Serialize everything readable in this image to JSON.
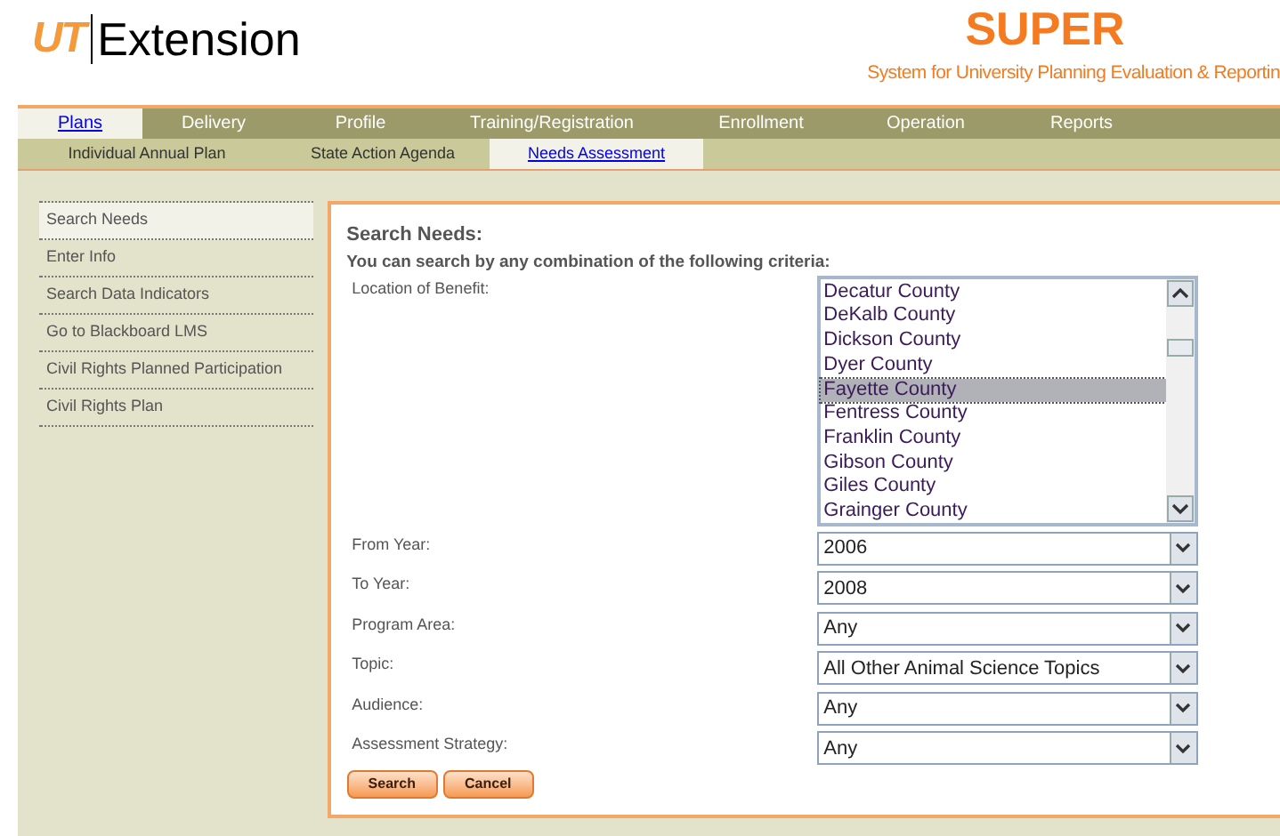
{
  "header": {
    "logo_mark": "UT",
    "logo_text": "Extension",
    "app_title": "SUPER",
    "app_subtitle": "System for University Planning Evaluation & Reportin"
  },
  "nav": [
    {
      "label": "Plans",
      "selected": true
    },
    {
      "label": "Delivery",
      "selected": false
    },
    {
      "label": "Profile",
      "selected": false
    },
    {
      "label": "Training/Registration",
      "selected": false
    },
    {
      "label": "Enrollment",
      "selected": false
    },
    {
      "label": "Operation",
      "selected": false
    },
    {
      "label": "Reports",
      "selected": false
    }
  ],
  "subnav": [
    {
      "label": "Individual Annual Plan",
      "selected": false
    },
    {
      "label": "State Action Agenda",
      "selected": false
    },
    {
      "label": "Needs Assessment",
      "selected": true
    }
  ],
  "sidebar": {
    "items": [
      {
        "label": "Search Needs",
        "selected": true
      },
      {
        "label": "Enter Info",
        "selected": false
      },
      {
        "label": "Search Data Indicators",
        "selected": false
      },
      {
        "label": "Go to Blackboard LMS",
        "selected": false
      },
      {
        "label": "Civil Rights Planned Participation",
        "selected": false
      },
      {
        "label": "Civil Rights Plan",
        "selected": false
      }
    ]
  },
  "form": {
    "title": "Search Needs:",
    "subtitle": "You can search by any combination of the following criteria:",
    "location": {
      "label": "Location of Benefit:",
      "options": [
        {
          "label": "Decatur County",
          "selected": false
        },
        {
          "label": "DeKalb County",
          "selected": false
        },
        {
          "label": "Dickson County",
          "selected": false
        },
        {
          "label": "Dyer County",
          "selected": false
        },
        {
          "label": "Fayette County",
          "selected": true
        },
        {
          "label": "Fentress County",
          "selected": false
        },
        {
          "label": "Franklin County",
          "selected": false
        },
        {
          "label": "Gibson County",
          "selected": false
        },
        {
          "label": "Giles County",
          "selected": false
        },
        {
          "label": "Grainger County",
          "selected": false
        }
      ]
    },
    "fields": [
      {
        "label": "From Year:",
        "value": "2006"
      },
      {
        "label": "To Year:",
        "value": "2008"
      },
      {
        "label": "Program Area:",
        "value": "Any"
      },
      {
        "label": "Topic:",
        "value": "All Other Animal Science Topics"
      },
      {
        "label": "Audience:",
        "value": "Any"
      },
      {
        "label": "Assessment Strategy:",
        "value": "Any"
      }
    ],
    "buttons": [
      "Search",
      "Cancel"
    ]
  }
}
